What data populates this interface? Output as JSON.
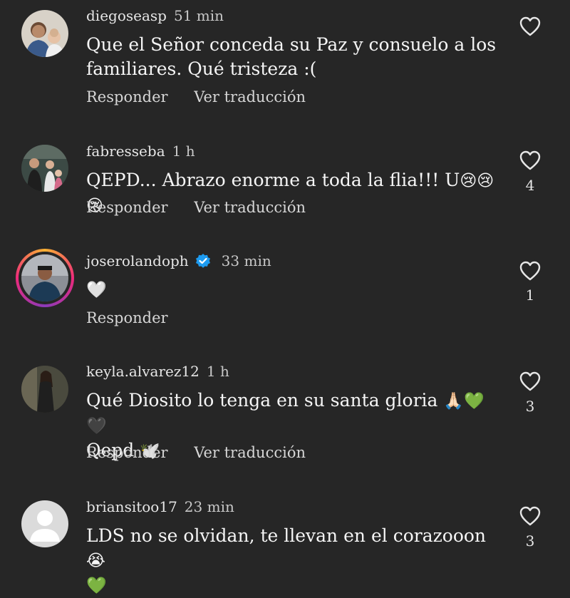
{
  "comments": [
    {
      "username": "diegoseasp",
      "time": "51 min",
      "text_line1": "Que el Señor conceda su Paz y consuelo a los",
      "text_line2": "familiares. Qué tristeza :(",
      "reply": "Responder",
      "translate": "Ver traducción",
      "likes": ""
    },
    {
      "username": "fabresseba",
      "time": "1 h",
      "text": "QEPD... Abrazo enorme a toda la flia!!! U",
      "emojis": "😢😢😢",
      "reply": "Responder",
      "translate": "Ver traducción",
      "likes": "4"
    },
    {
      "username": "joserolandoph",
      "time": "33 min",
      "emojis": "🤍",
      "reply": "Responder",
      "likes": "1"
    },
    {
      "username": "keyla.alvarez12",
      "time": "1 h",
      "text_line1": "Qué Diosito lo tenga en su santa gloria",
      "emojis_line1": "🙏🏻💚🖤",
      "text_line2": "Qepd",
      "emojis_line2": "🕊️",
      "reply": "Responder",
      "translate": "Ver traducción",
      "likes": "3"
    },
    {
      "username": "briansitoo17",
      "time": "23 min",
      "text_line1": "LDS no se olvidan, te llevan en el corazooon",
      "emojis_line1": "😭",
      "emojis_line2": "💚",
      "likes": "3"
    }
  ],
  "icons": {
    "like": "heart-outline-icon",
    "verified": "verified-badge-icon",
    "default_avatar": "default-avatar-icon"
  },
  "colors": {
    "background": "#262626",
    "verified": "#1d9bf0"
  }
}
